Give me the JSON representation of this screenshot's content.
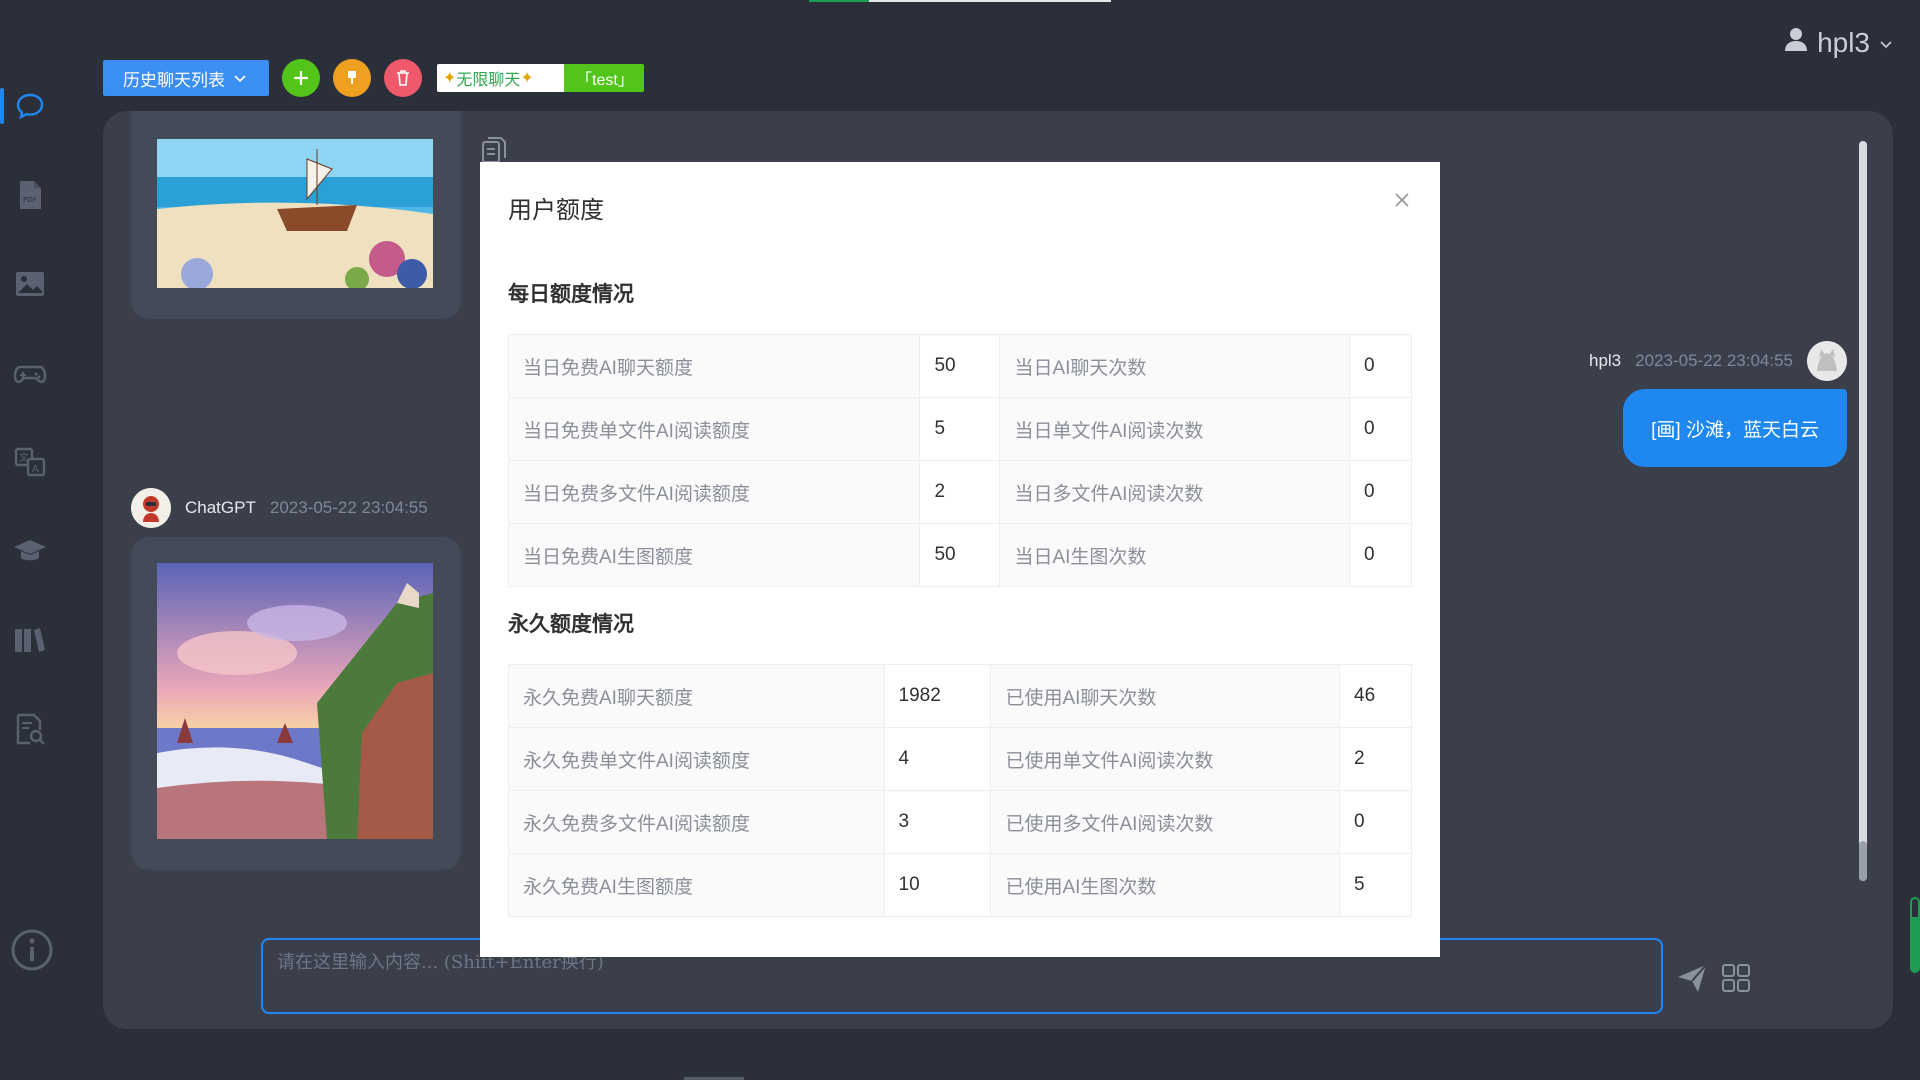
{
  "toolbar": {
    "history_label": "历史聊天列表",
    "badge_unlimited": "无限聊天",
    "badge_test": "「test」"
  },
  "user_menu": {
    "username": "hpl3"
  },
  "chat": {
    "bot_name": "ChatGPT",
    "bot_time": "2023-05-22 23:04:55",
    "user_name": "hpl3",
    "user_time": "2023-05-22 23:04:55",
    "user_message": "[画] 沙滩，蓝天白云",
    "input_placeholder": "请在这里输入内容... (Shift+Enter换行)"
  },
  "sidebar": {
    "items": [
      "chat-icon",
      "pdf-icon",
      "image-icon",
      "gamepad-icon",
      "translate-icon",
      "graduation-cap-icon",
      "books-icon",
      "search-doc-icon"
    ],
    "bottom": "info-icon"
  },
  "modal": {
    "title": "用户额度",
    "daily_title": "每日额度情况",
    "daily_rows": [
      {
        "l1": "当日免费AI聊天额度",
        "v1": "50",
        "l2": "当日AI聊天次数",
        "v2": "0"
      },
      {
        "l1": "当日免费单文件AI阅读额度",
        "v1": "5",
        "l2": "当日单文件AI阅读次数",
        "v2": "0"
      },
      {
        "l1": "当日免费多文件AI阅读额度",
        "v1": "2",
        "l2": "当日多文件AI阅读次数",
        "v2": "0"
      },
      {
        "l1": "当日免费AI生图额度",
        "v1": "50",
        "l2": "当日AI生图次数",
        "v2": "0"
      }
    ],
    "permanent_title": "永久额度情况",
    "permanent_rows": [
      {
        "l1": "永久免费AI聊天额度",
        "v1": "1982",
        "l2": "已使用AI聊天次数",
        "v2": "46"
      },
      {
        "l1": "永久免费单文件AI阅读额度",
        "v1": "4",
        "l2": "已使用单文件AI阅读次数",
        "v2": "2"
      },
      {
        "l1": "永久免费多文件AI阅读额度",
        "v1": "3",
        "l2": "已使用多文件AI阅读次数",
        "v2": "0"
      },
      {
        "l1": "永久免费AI生图额度",
        "v1": "10",
        "l2": "已使用AI生图次数",
        "v2": "5"
      }
    ]
  },
  "colors": {
    "accent": "#1e88f0",
    "add_button": "#52c41a",
    "pin_button": "#f0a020",
    "delete_button": "#f0596b",
    "background": "#2b2f3a"
  },
  "indicator_level": 0.75
}
